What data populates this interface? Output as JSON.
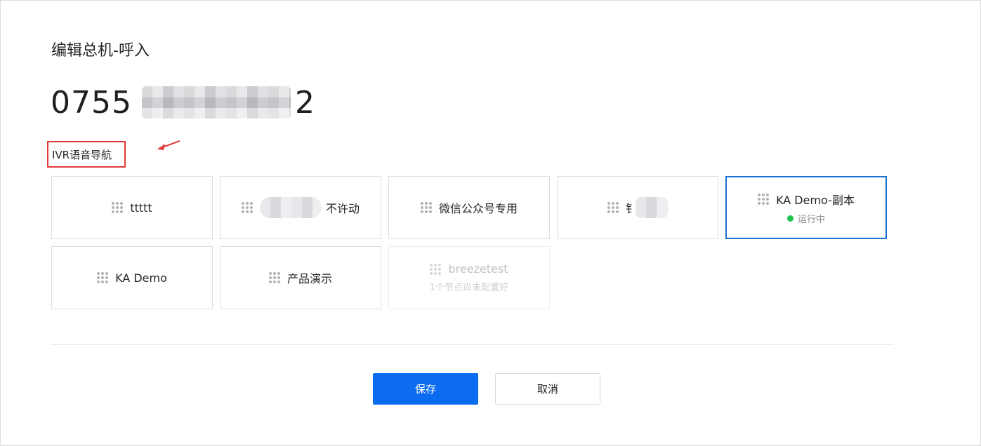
{
  "dialog": {
    "title": "编辑总机-呼入",
    "phone_prefix": "0755",
    "phone_suffix": "2",
    "section_label": "IVR语音导航"
  },
  "ivr_cards": [
    {
      "label": "ttttt",
      "sub": "",
      "state": "normal"
    },
    {
      "label": "不许动",
      "sub": "",
      "state": "normal",
      "redacted_prefix": true
    },
    {
      "label": "微信公众号专用",
      "sub": "",
      "state": "normal"
    },
    {
      "label": "钅",
      "sub": "",
      "state": "normal",
      "redacted_suffix": true
    },
    {
      "label": "KA Demo-副本",
      "sub": "运行中",
      "state": "selected",
      "status_color": "#1fc24a"
    },
    {
      "label": "KA Demo",
      "sub": "",
      "state": "normal"
    },
    {
      "label": "产品演示",
      "sub": "",
      "state": "normal"
    },
    {
      "label": "breezetest",
      "sub": "1个节点尚未配置好",
      "state": "disabled"
    }
  ],
  "footer": {
    "save_label": "保存",
    "cancel_label": "取消"
  },
  "colors": {
    "primary": "#0b6cf0",
    "selected_border": "#1f6fd1",
    "highlight_box": "#e23a3a",
    "status_running": "#1fc24a"
  },
  "icons": {
    "card_handle": "drag-handle-icon",
    "annotation": "arrow-annotation-icon"
  }
}
